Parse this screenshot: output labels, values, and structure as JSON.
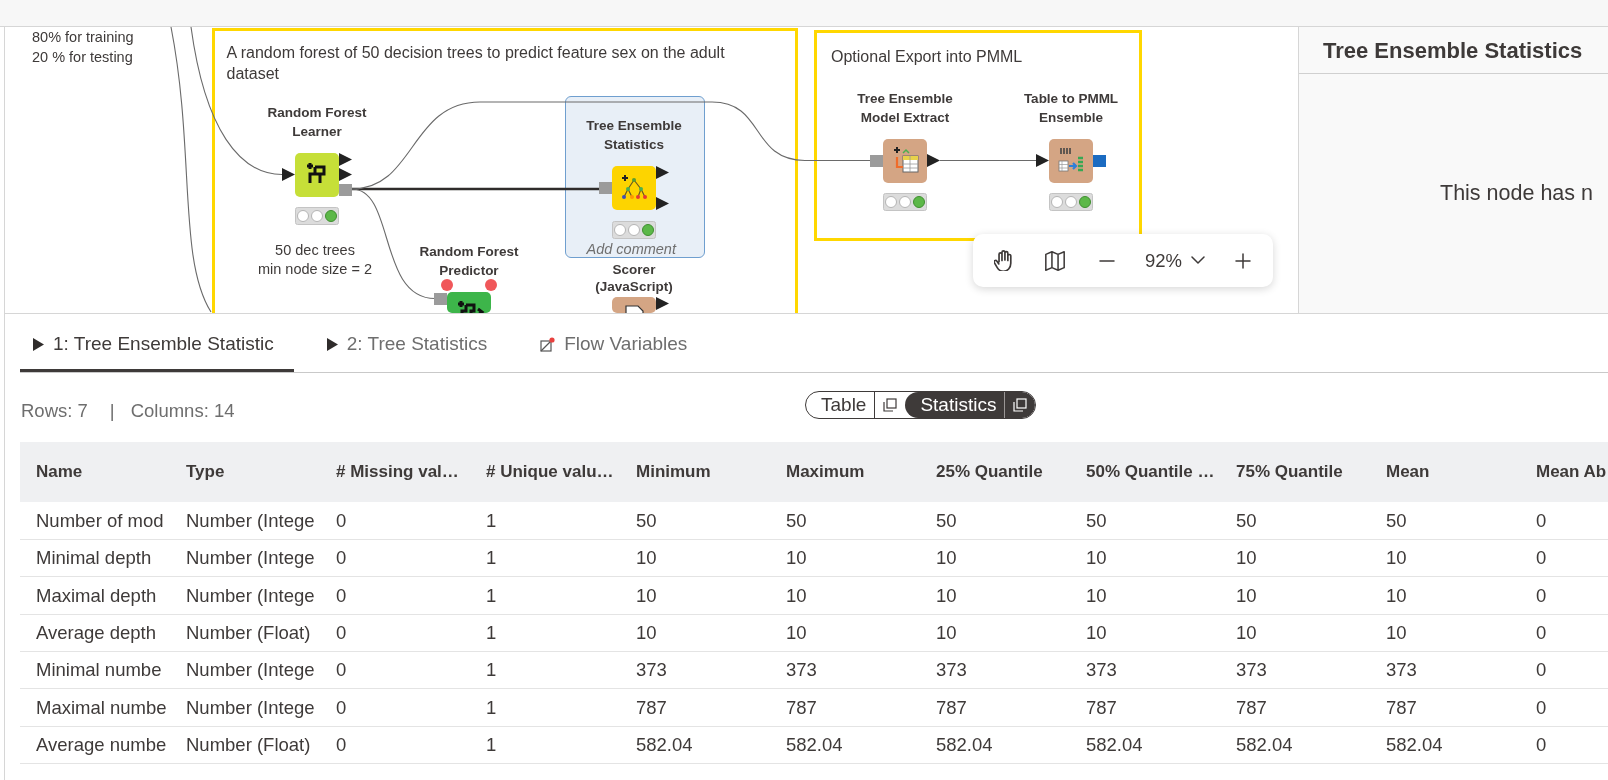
{
  "workflow_canvas": {
    "offscreen_node_comment": "80% for training\n20 % for testing",
    "annotations": [
      {
        "text": "A random forest of 50 decision trees to predict feature sex on the adult dataset"
      },
      {
        "text": "Optional Export into PMML"
      }
    ],
    "nodes": [
      {
        "label": "Random Forest Learner",
        "kind": "learner",
        "color": "#c6df38",
        "executed": true,
        "selected": false,
        "flow_variable_ports": false,
        "comment": "50 dec trees\nmin node size = 2"
      },
      {
        "label": "Random Forest Predictor",
        "kind": "predictor",
        "color": "#3db54a",
        "selected": false,
        "flow_variable_ports": true
      },
      {
        "label": "Tree Ensemble Statistics",
        "kind": "statistics",
        "color": "#fdd400",
        "executed": true,
        "selected": true,
        "flow_variable_ports": false,
        "comment_placeholder": "Add comment"
      },
      {
        "label": "Scorer (JavaScript)",
        "kind": "scorer",
        "color": "#d4a584",
        "selected": false,
        "flow_variable_ports": false
      },
      {
        "label": "Tree Ensemble Model Extract",
        "kind": "extractor",
        "color": "#d4a584",
        "executed": true,
        "selected": false,
        "flow_variable_ports": false
      },
      {
        "label": "Table to PMML Ensemble",
        "kind": "pmml_writer",
        "color": "#d4a584",
        "executed": true,
        "selected": false,
        "flow_variable_ports": false
      }
    ],
    "zoom_controls": {
      "zoom_level": "92%"
    }
  },
  "node_view_panel": {
    "title": "Tree Ensemble Statistics",
    "message": "This node has n"
  },
  "output_tabs": [
    {
      "label": "1: Tree Ensemble Statistic",
      "kind": "port",
      "selected": true
    },
    {
      "label": "2: Tree Statistics",
      "kind": "port",
      "selected": false
    },
    {
      "label": "Flow Variables",
      "kind": "flow_variables",
      "selected": false
    }
  ],
  "table_summary": {
    "rows": "Rows: 7",
    "separator": "|",
    "columns": "Columns: 14"
  },
  "view_toggle": [
    {
      "label": "Table",
      "selected": false
    },
    {
      "label": "Statistics",
      "selected": true
    }
  ],
  "table": {
    "columns": [
      "Name",
      "Type",
      "# Missing val…",
      "# Unique valu…",
      "Minimum",
      "Maximum",
      "25% Quantile",
      "50% Quantile …",
      "75% Quantile",
      "Mean",
      "Mean Ab"
    ],
    "rows": [
      [
        "Number of mod",
        "Number (Intege",
        "0",
        "1",
        "50",
        "50",
        "50",
        "50",
        "50",
        "50",
        "0"
      ],
      [
        "Minimal depth",
        "Number (Intege",
        "0",
        "1",
        "10",
        "10",
        "10",
        "10",
        "10",
        "10",
        "0"
      ],
      [
        "Maximal depth",
        "Number (Intege",
        "0",
        "1",
        "10",
        "10",
        "10",
        "10",
        "10",
        "10",
        "0"
      ],
      [
        "Average depth",
        "Number (Float)",
        "0",
        "1",
        "10",
        "10",
        "10",
        "10",
        "10",
        "10",
        "0"
      ],
      [
        "Minimal numbe",
        "Number (Intege",
        "0",
        "1",
        "373",
        "373",
        "373",
        "373",
        "373",
        "373",
        "0"
      ],
      [
        "Maximal numbe",
        "Number (Intege",
        "0",
        "1",
        "787",
        "787",
        "787",
        "787",
        "787",
        "787",
        "0"
      ],
      [
        "Average numbe",
        "Number (Float)",
        "0",
        "1",
        "582.04",
        "582.04",
        "582.04",
        "582.04",
        "582.04",
        "582.04",
        "0"
      ]
    ]
  }
}
